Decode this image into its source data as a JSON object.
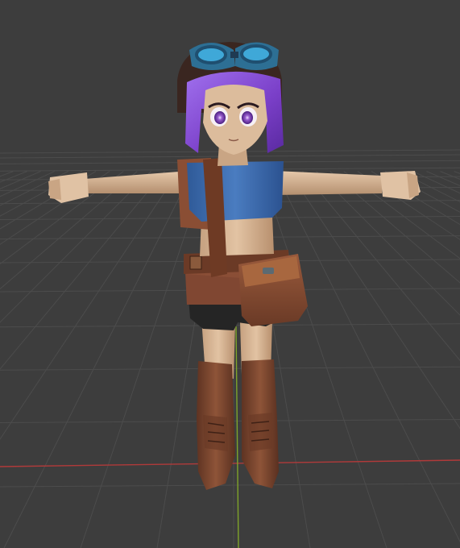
{
  "viewport": {
    "background": "#3d3d3d",
    "grid_color": "#4c4c4c",
    "x_axis_color": "#b03a3a",
    "y_axis_color": "#7fa32a"
  },
  "character": {
    "hair_color": "#8a4fd6",
    "skin_color": "#d9b898",
    "shirt_color": "#3c6db0",
    "leather_color": "#7a4630",
    "shorts_color": "#2a2a2a",
    "goggle_lens_color": "#3fa8d8",
    "eye_color": "#9a5fd0"
  }
}
